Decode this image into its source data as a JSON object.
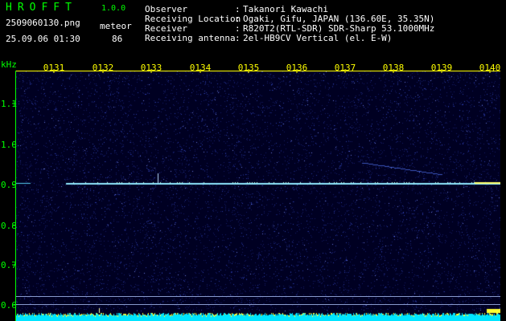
{
  "app": {
    "name": "HROFFT",
    "version": "1.0.0"
  },
  "recording": {
    "file_name": "2509060130.png",
    "timestamp": "25.09.06 01:30",
    "event_label": "meteor",
    "event_count": "86"
  },
  "station": {
    "rows": [
      {
        "label": "Observer",
        "value": "Takanori Kawachi"
      },
      {
        "label": "Receiving Location",
        "value": "Ogaki, Gifu, JAPAN (136.60E, 35.35N)"
      },
      {
        "label": "Receiver",
        "value": "R820T2(RTL-SDR) SDR-Sharp 53.1000MHz"
      },
      {
        "label": "Receiving antenna",
        "value": "2el-HB9CV Vertical (el. E-W)"
      }
    ]
  },
  "spectrogram": {
    "y_unit": "kHz",
    "y_ticks": [
      "1.1",
      "1.0",
      "0.9",
      "0.8",
      "0.7",
      "0.6"
    ],
    "x_ticks": [
      "0131",
      "0132",
      "0133",
      "0134",
      "0135",
      "0136",
      "0137",
      "0138",
      "0139",
      "0140"
    ],
    "beacon_khz": 0.905,
    "colors": {
      "axis_green": "#00ff00",
      "time_yellow": "#ffff00",
      "noise_blue": "#2233aa",
      "signal_cyan": "#aaffee",
      "power_bar_cyan": "#00e5ff",
      "power_bar_yellow": "#ffff33"
    }
  }
}
